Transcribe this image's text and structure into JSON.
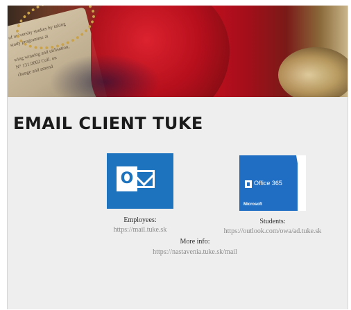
{
  "page": {
    "title": "EMAIL CLIENT TUKE"
  },
  "banner": {
    "text_lines": [
      "of university studies by taking",
      "study programme at",
      "",
      "wing winning and utilisation,",
      "N° 131/2002 Coll. on",
      "change and amend"
    ]
  },
  "clients": {
    "outlook": {
      "icon": "outlook-icon",
      "glyph": "O",
      "label": "Employees:",
      "url": "https://mail.tuke.sk"
    },
    "office365": {
      "icon": "office365-icon",
      "brand_text": "Office 365",
      "maker_text": "Microsoft",
      "label": "Students:",
      "url": "https://outlook.com/owa/ad.tuke.sk"
    }
  },
  "more_info": {
    "label": "More info:",
    "url": "https://nastavenia.tuke.sk/mail"
  },
  "colors": {
    "outlook_blue": "#1e73be",
    "office_blue": "#1f6ec4",
    "banner_red": "#c8101f",
    "background": "#eeeeef",
    "url_gray": "#8a8a8a"
  }
}
